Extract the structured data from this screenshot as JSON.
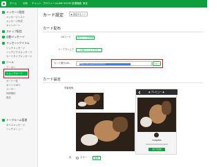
{
  "topbar": {
    "items": [
      "ホーム",
      "分析",
      "チャット",
      "プロフィール",
      "LINE VOOM",
      "拡張機能",
      "設定"
    ]
  },
  "sidebar": {
    "sections": [
      {
        "label": "メッセージ配信",
        "items": [
          "メッセージリスト",
          "メッセージ作成",
          "キャンペーン"
        ]
      },
      {
        "label": "ステップ配信",
        "items": []
      },
      {
        "label": "自動メッセージ",
        "items": []
      },
      {
        "label": "メッセージアイテム",
        "items": [
          "リッチメッセージ",
          "リッチビデオメッセージ",
          "カードタイプメッセージ"
        ]
      },
      {
        "label": "ツール",
        "items": [
          "クーポン",
          "ショップカード",
          "カード一覧",
          "ポイントNFC",
          "ユーザー",
          "利用規約",
          "設定"
        ]
      },
      {
        "label": "トークルーム管理",
        "items": [
          "ボイスメッセージ",
          "リッチメニュー"
        ]
      }
    ]
  },
  "main": {
    "title": "カード設定",
    "help_label": "◆ 設定のヒント",
    "issue_section": "カード配布",
    "qr_label": "QRコード",
    "qr_button": "QRコードを印刷",
    "chat_label": "トークでシェア",
    "chat_button": "LINEでシェアする",
    "url_label": "カード発行URL",
    "url_value": "https://lin.ee/xxxxxxxxxx",
    "copy_label": "コピー",
    "settings_section": "カード設定",
    "bg_label": "背景画像",
    "preview_title": "◆ プレビュー ◆",
    "preview_name": "magaka",
    "preview_friend": "友だち追加",
    "color_label": "色",
    "color_option": "カラー",
    "edit_label": "編集"
  }
}
